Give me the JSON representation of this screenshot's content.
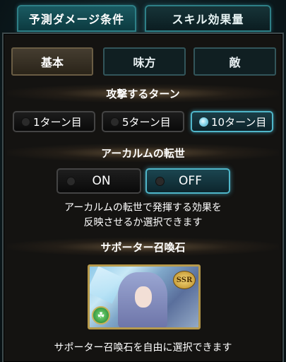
{
  "top_tabs": [
    {
      "label": "予測ダメージ条件",
      "active": true
    },
    {
      "label": "スキル効果量",
      "active": false
    }
  ],
  "sub_tabs": [
    {
      "label": "基本",
      "active": true
    },
    {
      "label": "味方",
      "active": false
    },
    {
      "label": "敵",
      "active": false
    }
  ],
  "attack_turn": {
    "title": "攻撃するターン",
    "options": [
      "1ターン目",
      "5ターン目",
      "10ターン目"
    ],
    "selected": "10ターン目"
  },
  "arcarum": {
    "title": "アーカルムの転世",
    "on_label": "ON",
    "off_label": "OFF",
    "selected": "OFF",
    "description_line1": "アーカルムの転世で発揮する効果を",
    "description_line2": "反映させるか選択できます"
  },
  "supporter": {
    "title": "サポーター召喚石",
    "card_rarity": "SSR",
    "element_symbol": "☘",
    "description": "サポーター召喚石を自由に選択できます"
  }
}
